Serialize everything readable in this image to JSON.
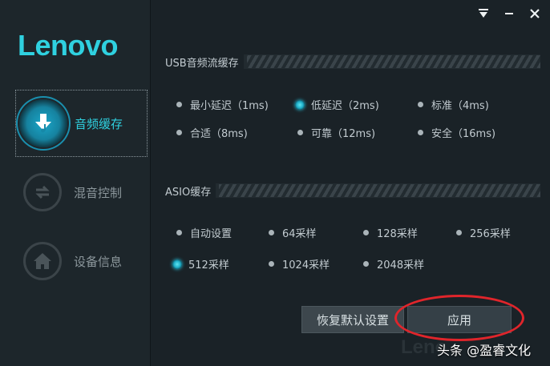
{
  "brand": {
    "logo": "Lenovo"
  },
  "window_controls": {
    "menu_icon": "menu-down-icon",
    "minimize_icon": "minimize-icon",
    "close_icon": "close-icon"
  },
  "sidebar": {
    "items": [
      {
        "label": "音频缓存",
        "icon": "music-download-icon",
        "active": true
      },
      {
        "label": "混音控制",
        "icon": "swap-arrows-icon",
        "active": false
      },
      {
        "label": "设备信息",
        "icon": "home-icon",
        "active": false
      }
    ]
  },
  "usb_section": {
    "title": "USB音频流缓存",
    "options": [
      "最小延迟（1ms)",
      "低延迟（2ms)",
      "标准（4ms)",
      "合适（8ms)",
      "可靠（12ms)",
      "安全（16ms)"
    ],
    "selected": "低延迟（2ms)"
  },
  "asio_section": {
    "title": "ASIO缓存",
    "options": [
      "自动设置",
      "64采样",
      "128采样",
      "256采样",
      "512采样",
      "1024采样",
      "2048采样"
    ],
    "selected": "512采样"
  },
  "buttons": {
    "restore": "恢复默认设置",
    "apply": "应用"
  },
  "watermark": {
    "text": "头条 @盈睿文化",
    "logo_ghost": "Leno"
  },
  "colors": {
    "accent": "#2fd1e0",
    "highlight_circle": "#e0252b"
  }
}
